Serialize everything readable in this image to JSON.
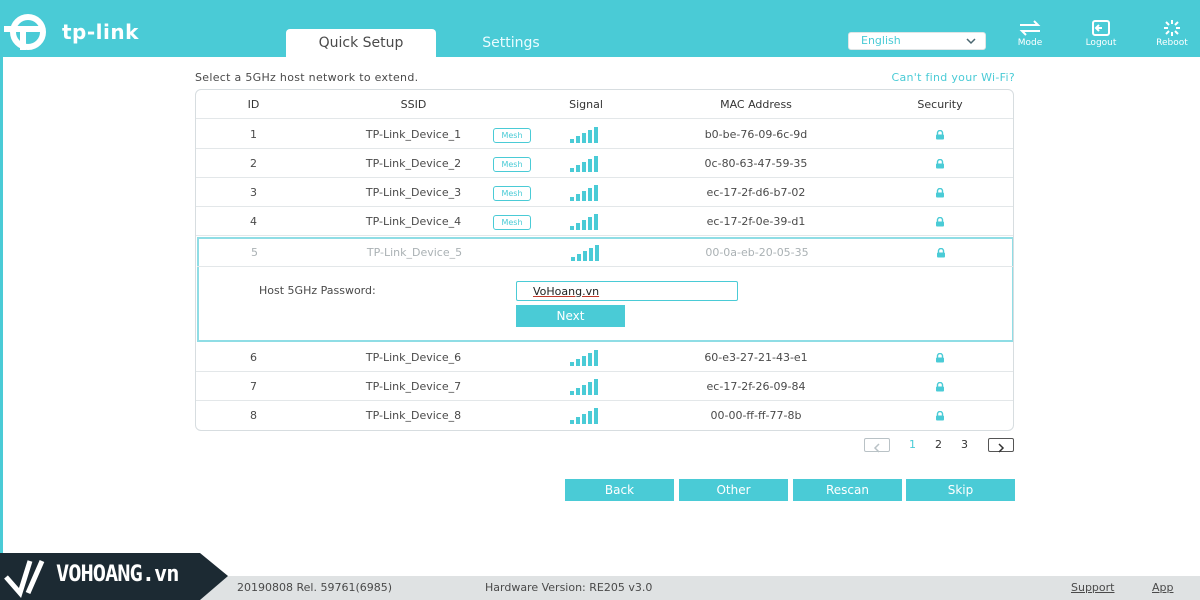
{
  "header": {
    "brand": "tp-link",
    "tabs": [
      {
        "label": "Quick Setup",
        "active": true
      },
      {
        "label": "Settings",
        "active": false
      }
    ],
    "language": "English",
    "buttons": [
      {
        "label": "Mode",
        "icon": "mode-icon"
      },
      {
        "label": "Logout",
        "icon": "logout-icon"
      },
      {
        "label": "Reboot",
        "icon": "reboot-icon"
      }
    ]
  },
  "main": {
    "instruction": "Select a 5GHz host network to extend.",
    "cant_find_link": "Can't find your Wi-Fi?",
    "table": {
      "columns": [
        "ID",
        "SSID",
        "Signal",
        "MAC Address",
        "Security"
      ],
      "rows": [
        {
          "id": "1",
          "ssid": "TP-Link_Device_1",
          "mesh": "Mesh",
          "signal_bars": 5,
          "mac": "b0-be-76-09-6c-9d"
        },
        {
          "id": "2",
          "ssid": "TP-Link_Device_2",
          "mesh": "Mesh",
          "signal_bars": 5,
          "mac": "0c-80-63-47-59-35"
        },
        {
          "id": "3",
          "ssid": "TP-Link_Device_3",
          "mesh": "Mesh",
          "signal_bars": 5,
          "mac": "ec-17-2f-d6-b7-02"
        },
        {
          "id": "4",
          "ssid": "TP-Link_Device_4",
          "mesh": "Mesh",
          "signal_bars": 5,
          "mac": "ec-17-2f-0e-39-d1"
        },
        {
          "id": "5",
          "ssid": "TP-Link_Device_5",
          "mesh": "",
          "signal_bars": 5,
          "mac": "00-0a-eb-20-05-35",
          "selected": true
        },
        {
          "id": "6",
          "ssid": "TP-Link_Device_6",
          "mesh": "",
          "signal_bars": 5,
          "mac": "60-e3-27-21-43-e1"
        },
        {
          "id": "7",
          "ssid": "TP-Link_Device_7",
          "mesh": "",
          "signal_bars": 5,
          "mac": "ec-17-2f-26-09-84"
        },
        {
          "id": "8",
          "ssid": "TP-Link_Device_8",
          "mesh": "",
          "signal_bars": 5,
          "mac": "00-00-ff-ff-77-8b"
        }
      ]
    },
    "password": {
      "label": "Host 5GHz Password:",
      "value": "VoHoang.vn",
      "next_label": "Next"
    },
    "pagination": {
      "pages": [
        "1",
        "2",
        "3"
      ],
      "current": "1"
    },
    "actions": {
      "back": "Back",
      "other": "Other",
      "rescan": "Rescan",
      "skip": "Skip"
    }
  },
  "footer": {
    "firmware": "20190808 Rel. 59761(6985)",
    "hardware": "Hardware Version: RE205 v3.0",
    "support": "Support",
    "app": "App"
  },
  "watermark": {
    "text": "VOHOANG.vn"
  },
  "colors": {
    "accent": "#4acbd6",
    "footer_bg": "#dfe2e3",
    "dark": "#1c2a33"
  }
}
